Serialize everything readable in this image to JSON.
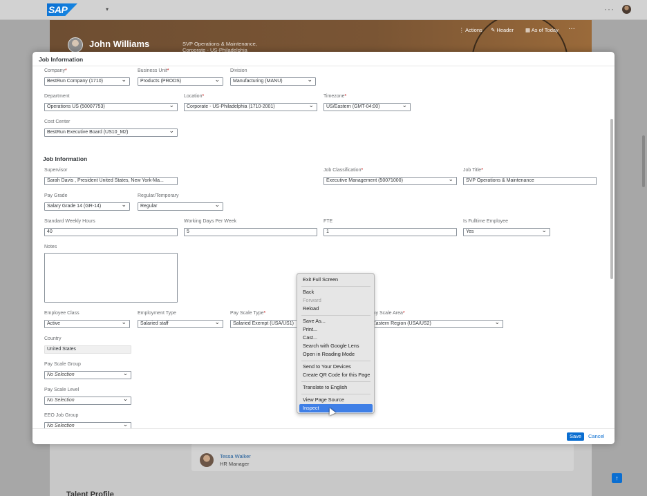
{
  "shell": {
    "logo": "SAP",
    "caret": "▾",
    "more": "···"
  },
  "header": {
    "name": "John Williams",
    "subtitle_line1": "SVP Operations & Maintenance,",
    "subtitle_line2": "Corporate - US-Philadelphia",
    "actions": "Actions",
    "header_btn": "Header",
    "as_of": "As of Today",
    "more": "···"
  },
  "behind": {
    "manager_name": "Tessa Walker",
    "manager_role": "HR Manager",
    "talent_profile": "Talent Profile"
  },
  "dialog": {
    "title": "Job Information",
    "save": "Save",
    "cancel": "Cancel",
    "org": {
      "company_label": "Company",
      "company_value": "BestRun Company (1710)",
      "business_unit_label": "Business Unit",
      "business_unit_value": "Products (PRODS)",
      "division_label": "Division",
      "division_value": "Manufacturing (MANU)",
      "department_label": "Department",
      "department_value": "Operations US (50007753)",
      "location_label": "Location",
      "location_value": "Corporate - US-Philadelphia (1710-2001)",
      "timezone_label": "Timezone",
      "timezone_value": "US/Eastern (GMT-04:00)",
      "cost_center_label": "Cost Center",
      "cost_center_value": "BestRun Executive Board (US10_M2)"
    },
    "job": {
      "section_title": "Job Information",
      "supervisor_label": "Supervisor",
      "supervisor_value": "Sarah Davis , President United States, New York-Ma...",
      "job_classification_label": "Job Classification",
      "job_classification_value": "Executive Management (50071000)",
      "job_title_label": "Job Title",
      "job_title_value": "SVP Operations & Maintenance",
      "pay_grade_label": "Pay Grade",
      "pay_grade_value": "Salary Grade 14 (GR-14)",
      "regular_label": "Regular/Temporary",
      "regular_value": "Regular",
      "std_hours_label": "Standard Weekly Hours",
      "std_hours_value": "40",
      "working_days_label": "Working Days Per Week",
      "working_days_value": "5",
      "fte_label": "FTE",
      "fte_value": "1",
      "fulltime_label": "Is Fulltime Employee",
      "fulltime_value": "Yes",
      "notes_label": "Notes",
      "employee_class_label": "Employee Class",
      "employee_class_value": "Active",
      "employment_type_label": "Employment Type",
      "employment_type_value": "Salaried staff",
      "pay_scale_type_label": "Pay Scale Type",
      "pay_scale_type_value": "Salaried Exempt (USA/US1)",
      "pay_scale_area_label": "Pay Scale Area",
      "pay_scale_area_value": "Eastern Region (USA/US2)",
      "country_label": "Country",
      "country_value": "United States",
      "pay_scale_group_label": "Pay Scale Group",
      "pay_scale_group_value": "No Selection",
      "pay_scale_level_label": "Pay Scale Level",
      "pay_scale_level_value": "No Selection",
      "eeo_label": "EEO Job Group",
      "eeo_value": "No Selection"
    }
  },
  "context_menu": {
    "exit_full_screen": "Exit Full Screen",
    "back": "Back",
    "forward": "Forward",
    "reload": "Reload",
    "save_as": "Save As...",
    "print": "Print...",
    "cast": "Cast...",
    "search_lens": "Search with Google Lens",
    "reading_mode": "Open in Reading Mode",
    "send_devices": "Send to Your Devices",
    "qr_code": "Create QR Code for this Page",
    "translate": "Translate to English",
    "view_source": "View Page Source",
    "inspect": "Inspect"
  }
}
